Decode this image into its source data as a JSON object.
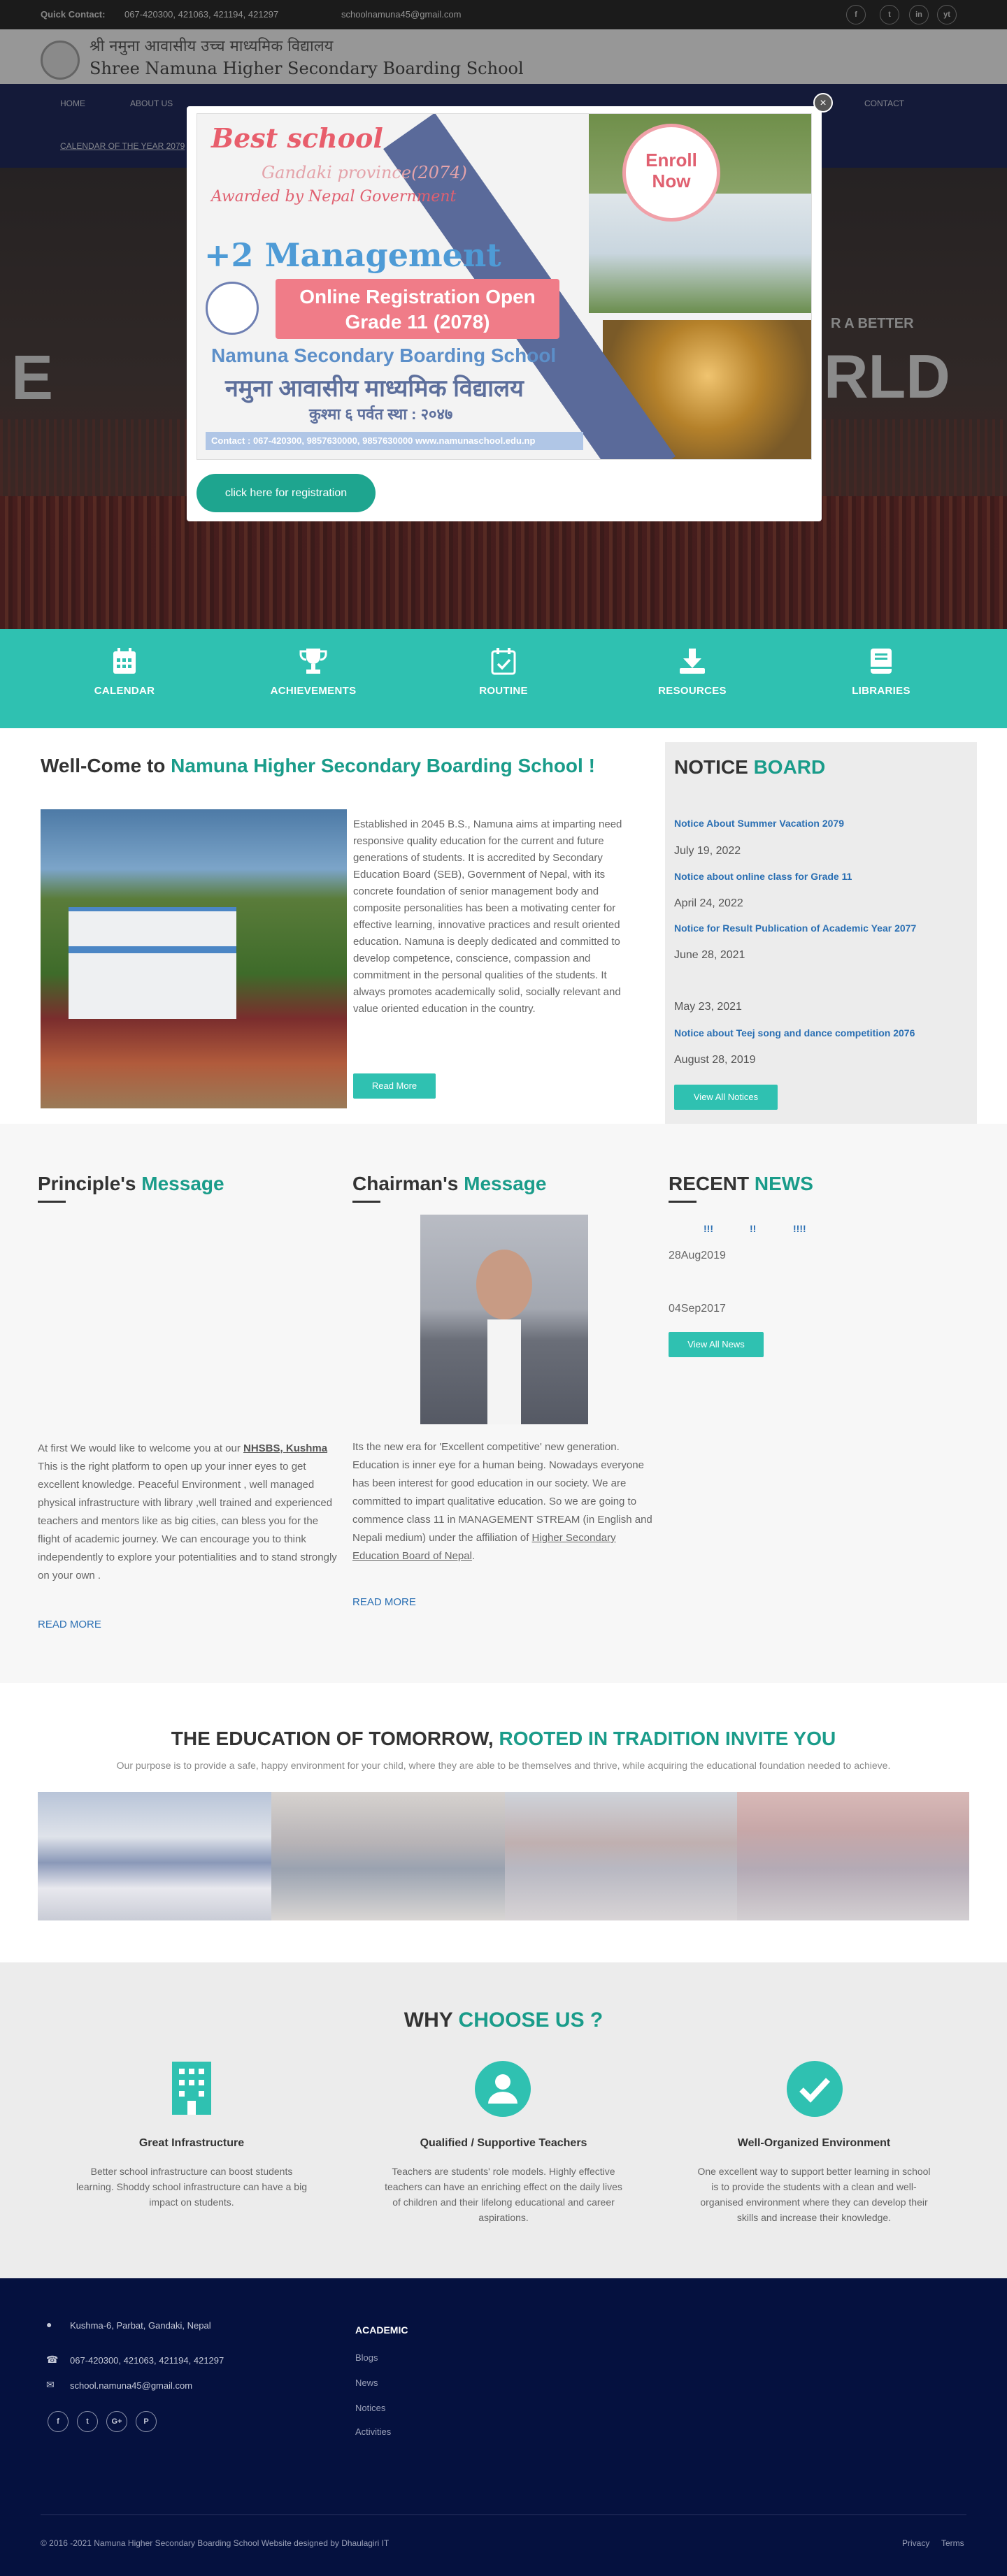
{
  "topbar": {
    "quick_contact": "Quick Contact:",
    "phone": "067-420300, 421063, 421194, 421297",
    "email": "schoolnamuna45@gmail.com",
    "social": [
      "f",
      "t",
      "in",
      "yt"
    ]
  },
  "header": {
    "name_np": "श्री नमुना आवासीय उच्च माध्यमिक विद्यालय",
    "name_en": "Shree Namuna Higher Secondary Boarding School"
  },
  "nav": {
    "items": [
      "HOME",
      "ABOUT US",
      "CONTACT"
    ],
    "sub": "CALENDAR OF THE YEAR 2079"
  },
  "hero": {
    "left_text": "E",
    "right_text": "RLD",
    "sub": "R A BETTER"
  },
  "modal": {
    "close": "×",
    "ad": {
      "best": "Best school",
      "gandaki": "Gandaki province(2074)",
      "award": "Awarded by  Nepal Government",
      "enroll": "Enroll Now",
      "management": "+2 Management",
      "online": "Online Registration Open Grade 11  (2078)",
      "school": "Namuna Secondary Boarding School",
      "school_np": "नमुना आवासीय माध्यमिक विद्यालय",
      "place_np": "कुश्मा ६ पर्वत स्था : २०४७",
      "contact": "Contact : 067-420300,  9857630000,  9857630000  www.namunaschool.edu.np"
    },
    "button": "click here for registration"
  },
  "tiles": [
    {
      "label": "CALENDAR",
      "icon": "calendar-icon"
    },
    {
      "label": "ACHIEVEMENTS",
      "icon": "trophy-icon"
    },
    {
      "label": "ROUTINE",
      "icon": "calendar-check-icon"
    },
    {
      "label": "RESOURCES",
      "icon": "download-icon"
    },
    {
      "label": "LIBRARIES",
      "icon": "book-icon"
    }
  ],
  "welcome": {
    "title_a": "Well-Come to ",
    "title_b": "Namuna Higher Secondary Boarding School !",
    "text": "Established in 2045 B.S., Namuna aims at imparting need responsive quality education for the current and future generations of students. It is accredited by  Secondary Education Board (SEB), Government of Nepal, with its concrete foundation of senior management body and composite personalities has been a motivating center for effective learning, innovative practices and result oriented education. Namuna is deeply dedicated and committed to develop competence, conscience, compassion and commitment in the personal qualities of the students. It always promotes academically solid, socially relevant and value oriented education in the country.",
    "read_more": "Read More"
  },
  "notice": {
    "title_a": "NOTICE ",
    "title_b": "BOARD",
    "items": [
      {
        "title": "Notice About Summer Vacation 2079",
        "date": "July 19, 2022"
      },
      {
        "title": "Notice about online class for Grade 11",
        "date": "April 24, 2022"
      },
      {
        "title": "Notice for Result Publication of Academic Year 2077",
        "date": "June 28, 2021"
      },
      {
        "title": "",
        "date": "May 23, 2021"
      },
      {
        "title": "Notice about Teej song and dance competition 2076",
        "date": "August 28, 2019"
      }
    ],
    "view_all": "View All Notices"
  },
  "principal": {
    "title_a": "Principle's ",
    "title_b": "Message",
    "text_a": "At first We would like to welcome you at our ",
    "link": "NHSBS, Kushma",
    "text_b": " This is the right platform to open up your inner eyes to get excellent knowledge. Peaceful Environment , well managed  physical infrastructure with library ,well trained and experienced  teachers and mentors like as big cities, can bless you for the flight of academic journey. We can encourage you to think independently to explore your potentialities and to stand strongly on your own .",
    "read_more": "READ MORE"
  },
  "chairman": {
    "title_a": "Chairman's ",
    "title_b": "Message",
    "text_a": "Its the new era for 'Excellent competitive' new generation. Education is inner eye for a human being. Nowadays everyone has been interest for good education in our society. We are committed to impart qualitative education. So we are going to commence class 11 in MANAGEMENT STREAM (in English and Nepali medium) under the affiliation of ",
    "link": "Higher Secondary Education Board of Nepal",
    "text_b": ".",
    "read_more": "READ MORE"
  },
  "news": {
    "title_a": "RECENT ",
    "title_b": "NEWS",
    "marks": [
      "!!!",
      "!!",
      "!!!!"
    ],
    "dates": [
      "28Aug2019",
      "04Sep2017"
    ],
    "view_all": "View All News"
  },
  "education": {
    "title_a": "THE EDUCATION OF TOMORROW, ",
    "title_b": "ROOTED IN TRADITION INVITE YOU",
    "sub": "Our purpose is to provide a safe, happy environment for your child, where they are able to be themselves and thrive, while acquiring the educational foundation needed to achieve."
  },
  "why": {
    "title_a": "WHY ",
    "title_b": "CHOOSE US ?",
    "items": [
      {
        "title": "Great Infrastructure",
        "text": "Better school infrastructure can boost students learning. Shoddy school infrastructure can have a big impact on students."
      },
      {
        "title": "Qualified / Supportive Teachers",
        "text": "Teachers are students' role models. Highly effective teachers can have an enriching effect on the daily lives of children and their lifelong educational and career aspirations."
      },
      {
        "title": "Well-Organized Environment",
        "text": "One excellent way to support better learning in school is to provide the students with a clean and well-organised environment where they can develop their skills and increase their knowledge."
      }
    ]
  },
  "footer": {
    "address": "Kushma-6, Parbat, Gandaki, Nepal",
    "phone": "067-420300, 421063, 421194, 421297",
    "email": "school.namuna45@gmail.com",
    "social": [
      "f",
      "t",
      "G+",
      "P"
    ],
    "academic_title": "ACADEMIC",
    "links": [
      "Blogs",
      "News",
      "Notices",
      "Activities"
    ],
    "copyright": "© 2016 -2021 Namuna Higher Secondary Boarding School Website designed by Dhaulagiri IT",
    "privacy": "Privacy",
    "terms": "Terms"
  },
  "colors": {
    "accent": "#2fc1b1",
    "accent_text": "#1a9c8a",
    "nav_bg": "#1f2858",
    "footer_bg": "#05113f",
    "link": "#2a6fb3"
  }
}
